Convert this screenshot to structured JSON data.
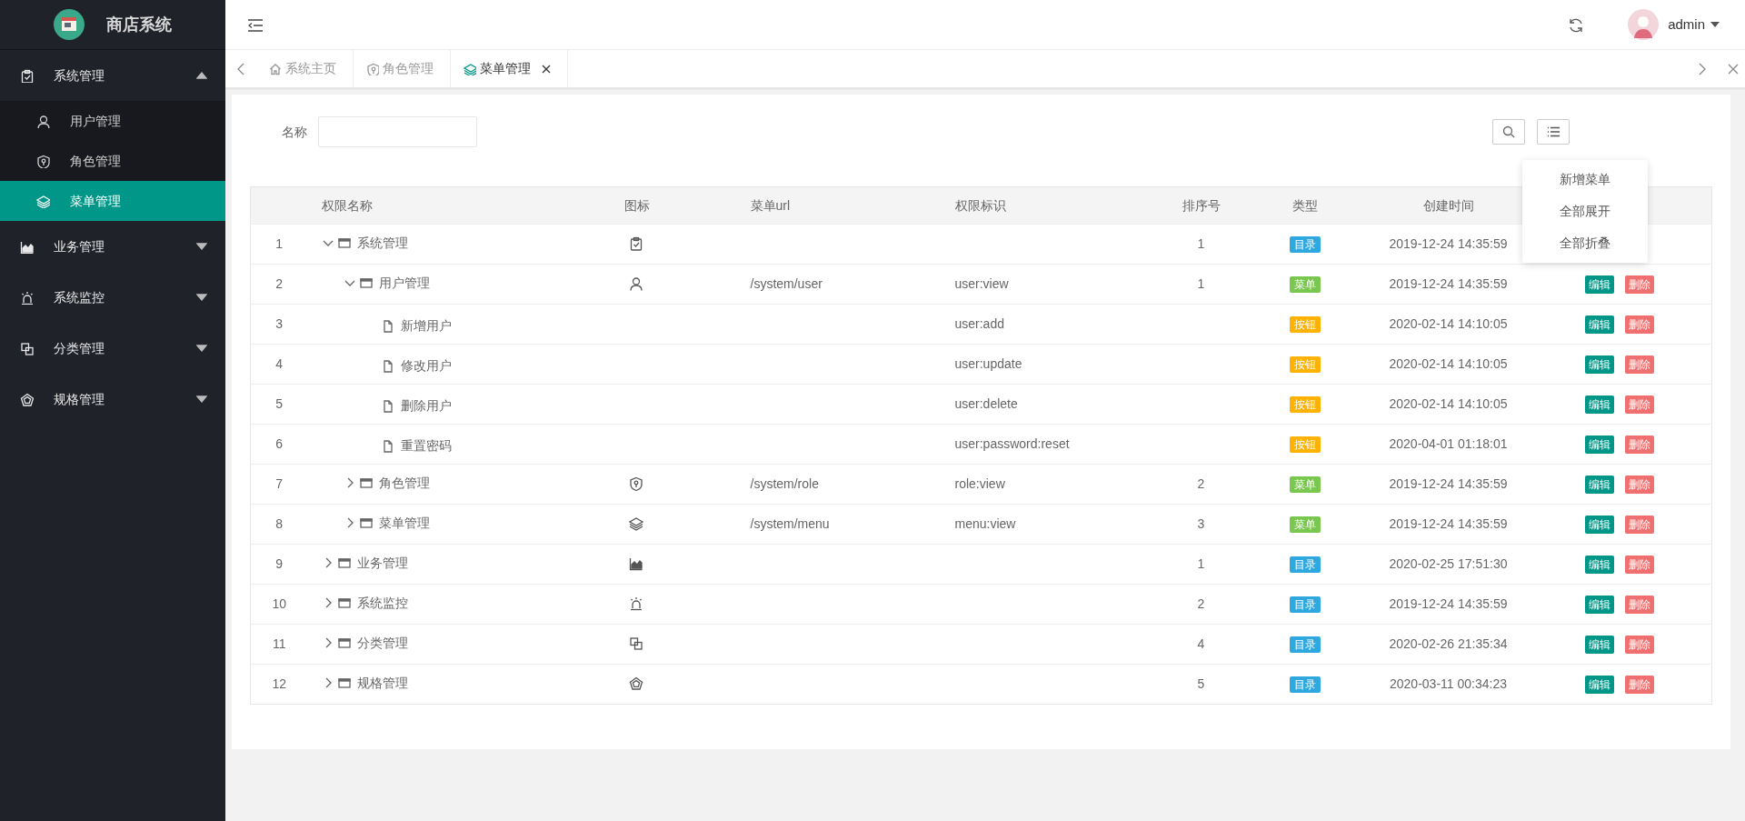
{
  "app": {
    "title": "商店系统"
  },
  "sidebar": {
    "groups": [
      {
        "label": "系统管理",
        "expanded": true,
        "items": [
          {
            "label": "用户管理",
            "selected": false
          },
          {
            "label": "角色管理",
            "selected": false
          },
          {
            "label": "菜单管理",
            "selected": true
          }
        ]
      },
      {
        "label": "业务管理",
        "expanded": false
      },
      {
        "label": "系统监控",
        "expanded": false
      },
      {
        "label": "分类管理",
        "expanded": false
      },
      {
        "label": "规格管理",
        "expanded": false
      }
    ]
  },
  "header": {
    "user": "admin"
  },
  "tabs": [
    {
      "label": "系统主页",
      "selected": false,
      "closable": false
    },
    {
      "label": "角色管理",
      "selected": false,
      "closable": false
    },
    {
      "label": "菜单管理",
      "selected": true,
      "closable": true
    }
  ],
  "search": {
    "label": "名称"
  },
  "tool_menu": {
    "items": [
      "新增菜单",
      "全部展开",
      "全部折叠"
    ]
  },
  "table": {
    "columns": [
      "权限名称",
      "图标",
      "菜单url",
      "权限标识",
      "排序号",
      "类型",
      "创建时间"
    ],
    "rows": [
      {
        "number": "1",
        "name": "系统管理",
        "kind": "folder",
        "expanded": true,
        "sort": "1",
        "type": {
          "label": "目录",
          "color": "#2fa8e0"
        },
        "created": "2019-12-24 14:35:59",
        "children": [
          {
            "number": "2",
            "name": "用户管理",
            "kind": "folder",
            "expanded": true,
            "url": "/system/user",
            "perm": "user:view",
            "sort": "1",
            "type": {
              "label": "菜单",
              "color": "#7ac74f"
            },
            "created": "2019-12-24 14:35:59",
            "actions": [
              "编辑",
              "删除"
            ],
            "children": [
              {
                "number": "3",
                "name": "新增用户",
                "kind": "leaf",
                "perm": "user:add",
                "type": {
                  "label": "按钮",
                  "color": "#ffb300"
                },
                "created": "2020-02-14 14:10:05",
                "actions": [
                  "编辑",
                  "删除"
                ]
              },
              {
                "number": "4",
                "name": "修改用户",
                "kind": "leaf",
                "perm": "user:update",
                "type": {
                  "label": "按钮",
                  "color": "#ffb300"
                },
                "created": "2020-02-14 14:10:05",
                "actions": [
                  "编辑",
                  "删除"
                ]
              },
              {
                "number": "5",
                "name": "删除用户",
                "kind": "leaf",
                "perm": "user:delete",
                "type": {
                  "label": "按钮",
                  "color": "#ffb300"
                },
                "created": "2020-02-14 14:10:05",
                "actions": [
                  "编辑",
                  "删除"
                ]
              },
              {
                "number": "6",
                "name": "重置密码",
                "kind": "leaf",
                "perm": "user:password:reset",
                "type": {
                  "label": "按钮",
                  "color": "#ffb300"
                },
                "created": "2020-04-01 01:18:01",
                "actions": [
                  "编辑",
                  "删除"
                ]
              }
            ]
          },
          {
            "number": "7",
            "name": "角色管理",
            "kind": "folder",
            "expanded": false,
            "url": "/system/role",
            "perm": "role:view",
            "sort": "2",
            "type": {
              "label": "菜单",
              "color": "#7ac74f"
            },
            "created": "2019-12-24 14:35:59",
            "actions": [
              "编辑",
              "删除"
            ]
          },
          {
            "number": "8",
            "name": "菜单管理",
            "kind": "folder",
            "expanded": false,
            "url": "/system/menu",
            "perm": "menu:view",
            "sort": "3",
            "type": {
              "label": "菜单",
              "color": "#7ac74f"
            },
            "created": "2019-12-24 14:35:59",
            "actions": [
              "编辑",
              "删除"
            ]
          }
        ]
      },
      {
        "number": "9",
        "name": "业务管理",
        "kind": "folder",
        "expanded": false,
        "sort": "1",
        "type": {
          "label": "目录",
          "color": "#2fa8e0"
        },
        "created": "2020-02-25 17:51:30",
        "actions": [
          "编辑",
          "删除"
        ]
      },
      {
        "number": "10",
        "name": "系统监控",
        "kind": "folder",
        "expanded": false,
        "sort": "2",
        "type": {
          "label": "目录",
          "color": "#2fa8e0"
        },
        "created": "2019-12-24 14:35:59",
        "actions": [
          "编辑",
          "删除"
        ]
      },
      {
        "number": "11",
        "name": "分类管理",
        "kind": "folder",
        "expanded": false,
        "sort": "4",
        "type": {
          "label": "目录",
          "color": "#2fa8e0"
        },
        "created": "2020-02-26 21:35:34",
        "actions": [
          "编辑",
          "删除"
        ]
      },
      {
        "number": "12",
        "name": "规格管理",
        "kind": "folder",
        "expanded": false,
        "sort": "5",
        "type": {
          "label": "目录",
          "color": "#2fa8e0"
        },
        "created": "2020-03-11 00:34:23",
        "actions": [
          "编辑",
          "删除"
        ]
      }
    ]
  }
}
